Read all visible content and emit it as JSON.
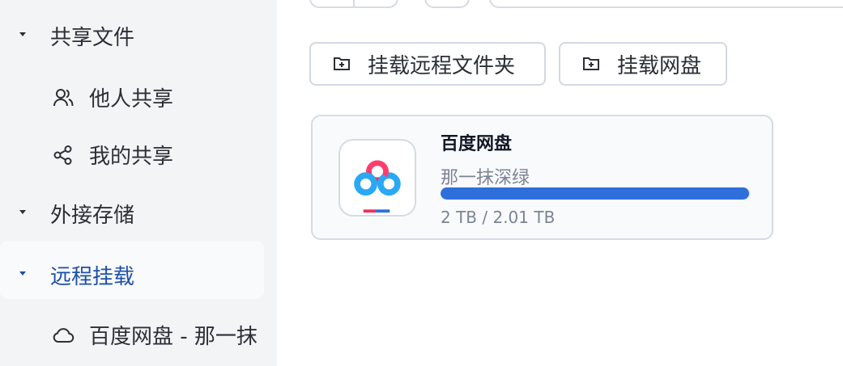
{
  "sidebar": {
    "shared_files": "共享文件",
    "others_share": "他人共享",
    "my_share": "我的共享",
    "external_storage": "外接存储",
    "remote_mount": "远程挂载",
    "baidu_item": "百度网盘 - 那一抹"
  },
  "toolbar": {
    "mount_remote_folder": "挂载远程文件夹",
    "mount_netdisk": "挂载网盘"
  },
  "card": {
    "title": "百度网盘",
    "account": "那一抹深绿",
    "usage": "2 TB / 2.01 TB",
    "progress_fraction": 0.995,
    "icon": "baidu-netdisk-icon"
  },
  "colors": {
    "accent": "#2f6fdb",
    "active_text": "#1e4fa8"
  }
}
